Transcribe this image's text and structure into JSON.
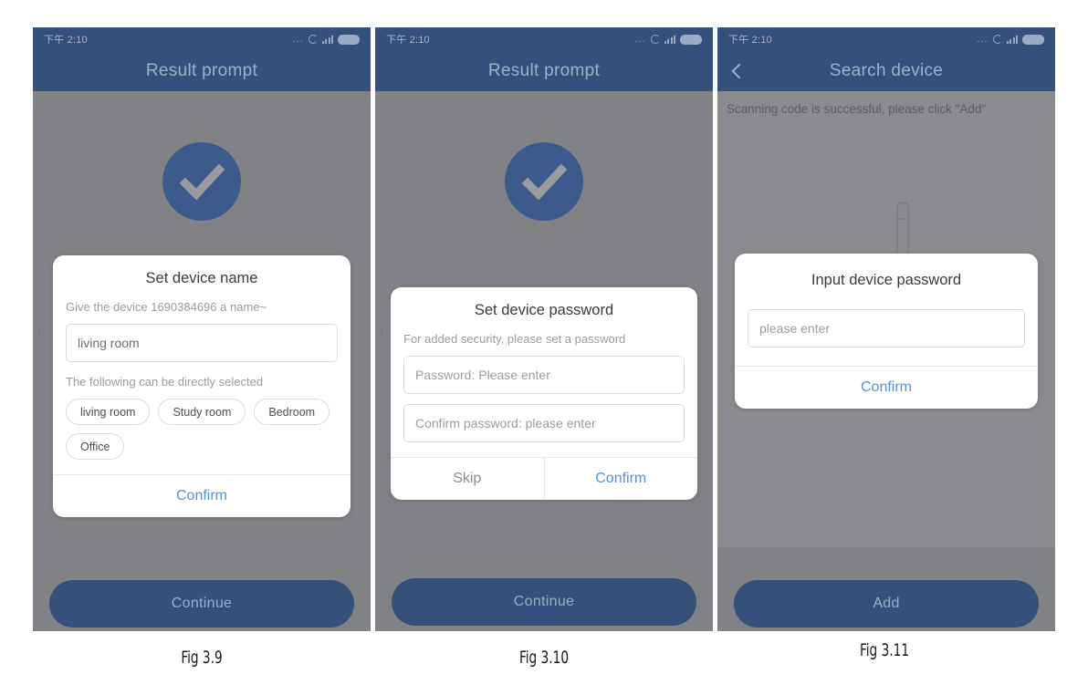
{
  "statusbar": {
    "time": "下午 2:10",
    "dots": "...",
    "icons": [
      "sync-circle-icon",
      "signal-bars-icon",
      "battery-icon"
    ]
  },
  "colors": {
    "header_blue": "#36507c",
    "screen_grey": "#818286",
    "badge_blue": "#3c5a8c",
    "link_blue": "#5b8ede",
    "cta_blue": "#36507c"
  },
  "panels": [
    {
      "caption": "Fig 3.9",
      "nav": {
        "title": "Result prompt",
        "back": false
      },
      "banner": null,
      "check_badge": true,
      "dialog": {
        "title": "Set device name",
        "subtitle": "Give the device 1690384696 a name~",
        "input_value": "living room",
        "input_placeholder": "living room",
        "hint": "The following can be directly selected",
        "chips": [
          "living room",
          "Study room",
          "Bedroom",
          "Office"
        ],
        "actions": [
          {
            "label": "Confirm",
            "style": "link"
          }
        ]
      },
      "cta": {
        "label": "Continue"
      }
    },
    {
      "caption": "Fig 3.10",
      "nav": {
        "title": "Result prompt",
        "back": false
      },
      "banner": null,
      "check_badge": true,
      "dialog": {
        "title": "Set device password",
        "subtitle": "For added security, please set a password",
        "fields": [
          {
            "placeholder": "Password: Please enter",
            "value": ""
          },
          {
            "placeholder": "Confirm password: please enter",
            "value": ""
          }
        ],
        "actions": [
          {
            "label": "Skip",
            "style": "plain"
          },
          {
            "label": "Confirm",
            "style": "link"
          }
        ]
      },
      "cta": {
        "label": "Continue"
      }
    },
    {
      "caption": "Fig 3.11",
      "nav": {
        "title": "Search device",
        "back": true
      },
      "banner": "Scanning code is successful, please click \"Add\"",
      "check_badge": false,
      "device_art": "router-antenna-illustration",
      "dialog": {
        "title": "Input device password",
        "fields": [
          {
            "placeholder": "please enter",
            "value": ""
          }
        ],
        "actions": [
          {
            "label": "Confirm",
            "style": "link"
          }
        ]
      },
      "cta": {
        "label": "Add"
      }
    }
  ]
}
